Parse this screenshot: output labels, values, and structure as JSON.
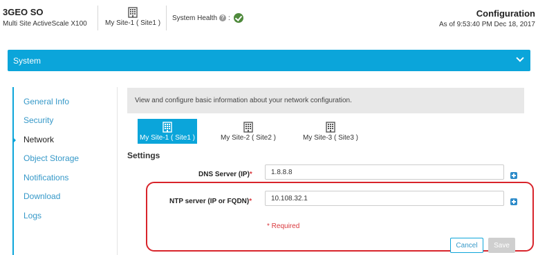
{
  "header": {
    "brand_title": "3GEO SO",
    "brand_subtitle": "Multi Site ActiveScale X100",
    "current_site": "My Site-1 ( Site1 )",
    "system_health_label": "System Health",
    "system_health_status": "ok",
    "page_title": "Configuration",
    "timestamp": "As of 9:53:40 PM Dec 18, 2017"
  },
  "section_bar": {
    "label": "System"
  },
  "sidebar": {
    "items": [
      {
        "label": "General Info"
      },
      {
        "label": "Security"
      },
      {
        "label": "Network",
        "active": true
      },
      {
        "label": "Object Storage"
      },
      {
        "label": "Notifications"
      },
      {
        "label": "Download"
      },
      {
        "label": "Logs"
      }
    ]
  },
  "main": {
    "banner_text": "View and configure basic information about your network configuration.",
    "site_tabs": [
      {
        "label": "My Site-1 ( Site1 )",
        "active": true
      },
      {
        "label": "My Site-2 ( Site2 )"
      },
      {
        "label": "My Site-3 ( Site3 )"
      }
    ],
    "settings_title": "Settings",
    "dns": {
      "label": "DNS Server (IP)",
      "required_mark": "*",
      "value": "1.8.8.8"
    },
    "ntp": {
      "label": "NTP server (IP or FQDN)",
      "required_mark": "*",
      "value": "10.108.32.1"
    },
    "required_note": "* Required",
    "cancel_label": "Cancel",
    "save_label": "Save"
  },
  "colors": {
    "accent": "#0ba5da",
    "link": "#3598c8",
    "required": "#d9373c",
    "health_ok": "#4f8a3c",
    "highlight": "#d8232a"
  }
}
